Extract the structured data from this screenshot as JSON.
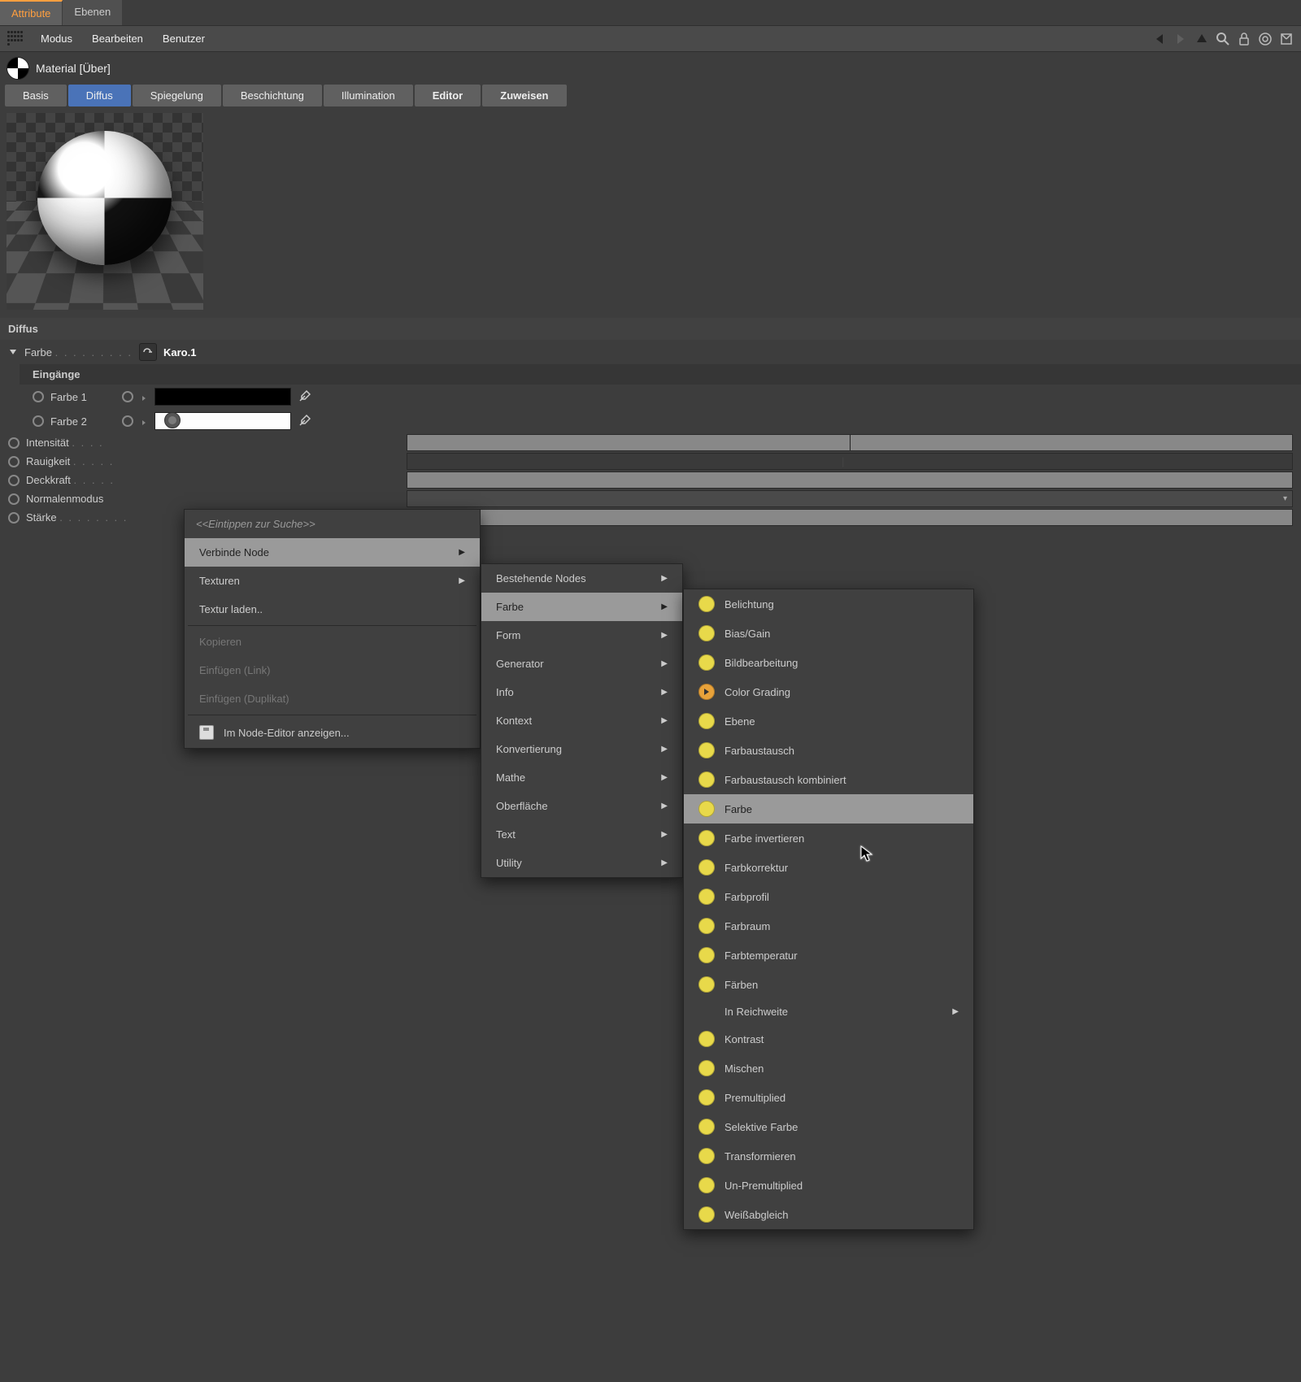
{
  "tabs": {
    "attribute": "Attribute",
    "layers": "Ebenen"
  },
  "menu": {
    "modus": "Modus",
    "bearbeiten": "Bearbeiten",
    "benutzer": "Benutzer"
  },
  "title": "Material [Über]",
  "subtabs": {
    "basis": "Basis",
    "diffus": "Diffus",
    "spiegelung": "Spiegelung",
    "beschichtung": "Beschichtung",
    "illumination": "Illumination",
    "editor": "Editor",
    "zuweisen": "Zuweisen"
  },
  "section": {
    "diffus": "Diffus",
    "eingaenge": "Eingänge"
  },
  "props": {
    "farbe": "Farbe",
    "karo": "Karo.1",
    "farbe1": "Farbe 1",
    "farbe2": "Farbe 2",
    "intensitaet": "Intensität",
    "rauigkeit": "Rauigkeit",
    "deckkraft": "Deckkraft",
    "normalenmodus": "Normalenmodus",
    "staerke": "Stärke"
  },
  "ctx1": {
    "search": "<<Eintippen zur Suche>>",
    "verbinde": "Verbinde Node",
    "texturen": "Texturen",
    "textur_laden": "Textur laden..",
    "kopieren": "Kopieren",
    "einf_link": "Einfügen (Link)",
    "einf_dup": "Einfügen (Duplikat)",
    "node_editor": "Im Node-Editor anzeigen..."
  },
  "ctx2": {
    "bestehende": "Bestehende Nodes",
    "farbe": "Farbe",
    "form": "Form",
    "generator": "Generator",
    "info": "Info",
    "kontext": "Kontext",
    "konvertierung": "Konvertierung",
    "mathe": "Mathe",
    "oberflaeche": "Oberfläche",
    "text": "Text",
    "utility": "Utility"
  },
  "ctx3": {
    "belichtung": "Belichtung",
    "biasgain": "Bias/Gain",
    "bildbearbeitung": "Bildbearbeitung",
    "colorgrading": "Color Grading",
    "ebene": "Ebene",
    "farbaustausch": "Farbaustausch",
    "farbaustausch_kombi": "Farbaustausch kombiniert",
    "farbe": "Farbe",
    "farbe_invert": "Farbe invertieren",
    "farbkorrektur": "Farbkorrektur",
    "farbprofil": "Farbprofil",
    "farbraum": "Farbraum",
    "farbtemperatur": "Farbtemperatur",
    "faerben": "Färben",
    "in_reichweite": "In Reichweite",
    "kontrast": "Kontrast",
    "mischen": "Mischen",
    "premultiplied": "Premultiplied",
    "selektive": "Selektive Farbe",
    "transformieren": "Transformieren",
    "unpremult": "Un-Premultiplied",
    "weissabgleich": "Weißabgleich"
  }
}
